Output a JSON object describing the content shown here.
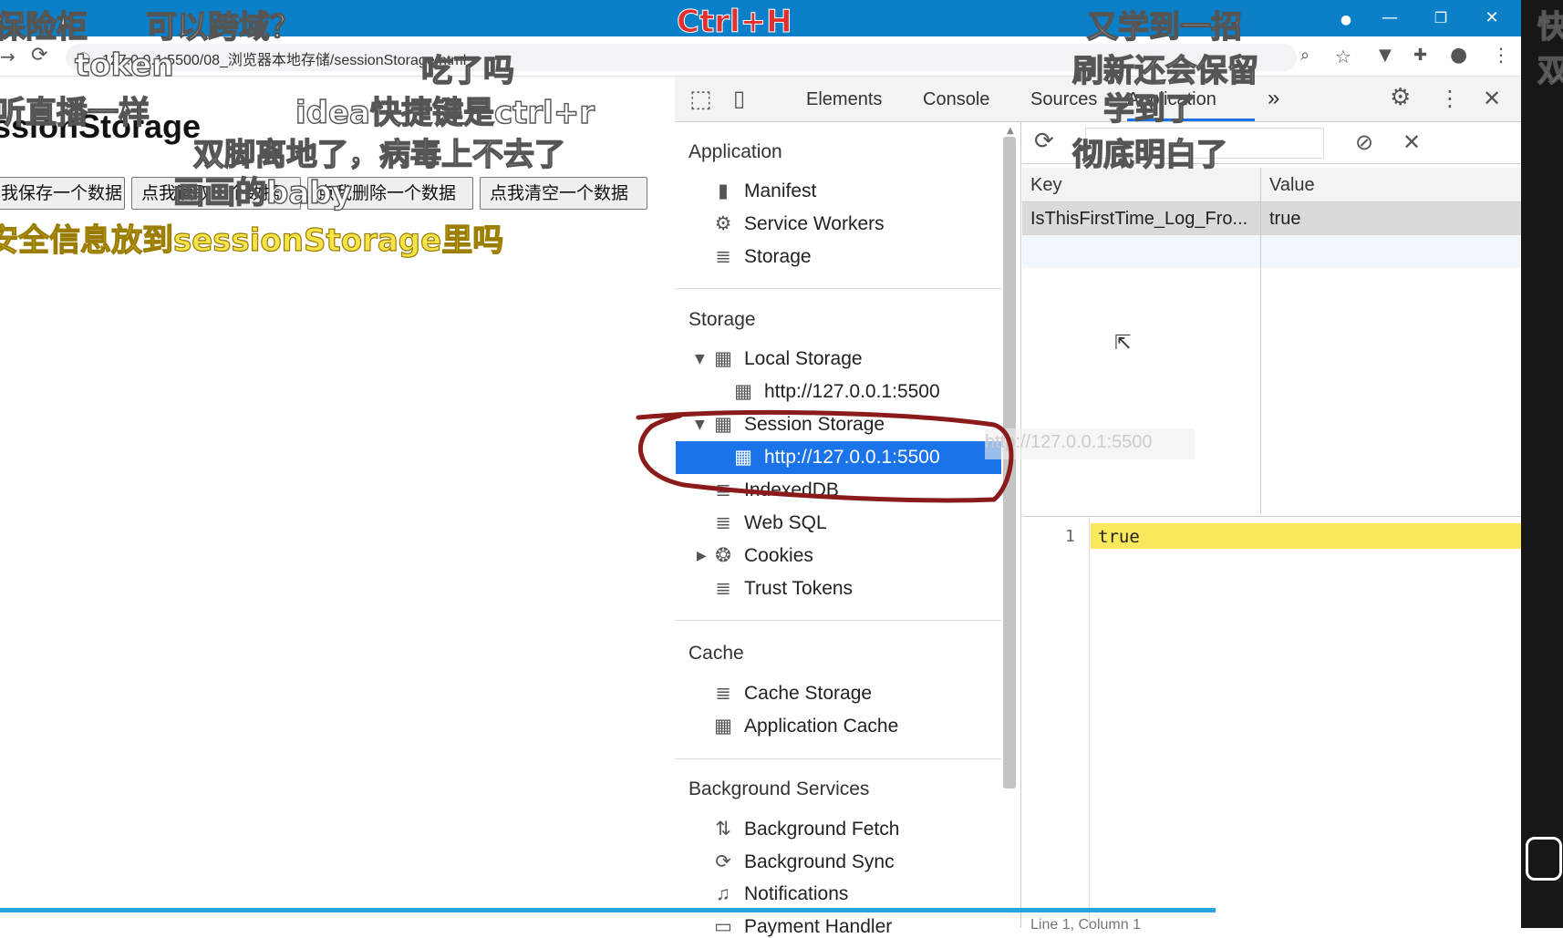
{
  "window": {
    "controls": {
      "minimize": "—",
      "restore": "❐",
      "close": "✕"
    }
  },
  "address_bar": {
    "url": "127.0.0.1:5500/08_浏览器本地存储/sessionStorage.html"
  },
  "page": {
    "title": "ssionStorage",
    "buttons": [
      "点我保存一个数据",
      "点我读取一个数据",
      "点我删除一个数据",
      "点我清空一个数据"
    ],
    "buttons_visible": [
      "我保存一个数据",
      "点我读取一个数据",
      "点我删除一个数据",
      "点我清空一个数据"
    ]
  },
  "devtools": {
    "tabs": [
      "Elements",
      "Console",
      "Sources",
      "Application"
    ],
    "active_tab": "Application",
    "more_tabs": "»",
    "sidebar": {
      "sections": [
        {
          "title": "Application",
          "items": [
            {
              "label": "Manifest",
              "icon": "file-icon"
            },
            {
              "label": "Service Workers",
              "icon": "gear-icon"
            },
            {
              "label": "Storage",
              "icon": "database-icon"
            }
          ]
        },
        {
          "title": "Storage",
          "items": [
            {
              "label": "Local Storage",
              "icon": "grid-icon",
              "expanded": true
            },
            {
              "label": "http://127.0.0.1:5500",
              "icon": "grid-icon",
              "child": true
            },
            {
              "label": "Session Storage",
              "icon": "grid-icon",
              "expanded": true
            },
            {
              "label": "http://127.0.0.1:5500",
              "icon": "grid-icon",
              "child": true,
              "selected": true
            },
            {
              "label": "IndexedDB",
              "icon": "database-icon"
            },
            {
              "label": "Web SQL",
              "icon": "database-icon"
            },
            {
              "label": "Cookies",
              "icon": "cookie-icon",
              "collapsed": true
            },
            {
              "label": "Trust Tokens",
              "icon": "database-icon"
            }
          ]
        },
        {
          "title": "Cache",
          "items": [
            {
              "label": "Cache Storage",
              "icon": "database-icon"
            },
            {
              "label": "Application Cache",
              "icon": "grid-icon"
            }
          ]
        },
        {
          "title": "Background Services",
          "items": [
            {
              "label": "Background Fetch",
              "icon": "arrows-icon"
            },
            {
              "label": "Background Sync",
              "icon": "sync-icon"
            },
            {
              "label": "Notifications",
              "icon": "bell-icon"
            },
            {
              "label": "Payment Handler",
              "icon": "card-icon"
            }
          ]
        }
      ]
    },
    "storage_table": {
      "columns": [
        "Key",
        "Value"
      ],
      "rows": [
        {
          "key": "IsThisFirstTime_Log_Fro...",
          "value": "true"
        }
      ],
      "drag_ghost": "http://127.0.0.1:5500"
    },
    "preview": {
      "line_number": "1",
      "content": "true",
      "status": "Line 1, Column 1"
    }
  },
  "overlays": [
    {
      "text": "保险柜",
      "style": "white"
    },
    {
      "text": "可以跨域？",
      "style": "white"
    },
    {
      "text": "Ctrl+H",
      "style": "red"
    },
    {
      "text": "又学到一招",
      "style": "white"
    },
    {
      "text": "token",
      "style": "white"
    },
    {
      "text": "吃了吗",
      "style": "white"
    },
    {
      "text": "刷新还会保留",
      "style": "white"
    },
    {
      "text": "听直播一样",
      "style": "white"
    },
    {
      "text": "idea快捷键是ctrl+r",
      "style": "white"
    },
    {
      "text": "学到了",
      "style": "white"
    },
    {
      "text": "双脚离地了，病毒上不去了",
      "style": "white"
    },
    {
      "text": "彻底明白了",
      "style": "white"
    },
    {
      "text": "画画的baby",
      "style": "white"
    },
    {
      "text": "安全信息放到sessionStorage里吗",
      "style": "yellow"
    },
    {
      "text": "快",
      "style": "white"
    },
    {
      "text": "双",
      "style": "white"
    }
  ],
  "colors": {
    "titlebar": "#0b7fc7",
    "selection": "#1a73e8",
    "highlight": "#fce85c",
    "annotation": "#8b1a1a"
  }
}
